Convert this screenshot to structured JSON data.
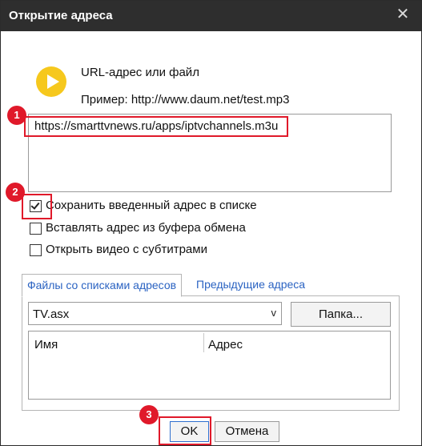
{
  "window": {
    "title": "Открытие адреса",
    "close_symbol": "✕"
  },
  "icon": "play-icon",
  "labels": {
    "url_or_file": "URL-адрес или файл",
    "example": "Пример: http://www.daum.net/test.mp3"
  },
  "url_input": {
    "value": "https://smarttvnews.ru/apps/iptvchannels.m3u"
  },
  "checkboxes": [
    {
      "label": "Сохранить введенный адрес в списке",
      "checked": true
    },
    {
      "label": "Вставлять адрес из буфера обмена",
      "checked": false
    },
    {
      "label": "Открыть видео с субтитрами",
      "checked": false
    }
  ],
  "tabs": [
    {
      "label": "Файлы со списками адресов",
      "active": true
    },
    {
      "label": "Предыдущие адреса",
      "active": false
    }
  ],
  "playlist_combo": {
    "value": "TV.asx",
    "arrow": "v"
  },
  "folder_button": "Папка...",
  "list_columns": [
    "Имя",
    "Адрес"
  ],
  "buttons": {
    "ok": "OK",
    "cancel": "Отмена"
  },
  "annotations": [
    "1",
    "2",
    "3"
  ],
  "colors": {
    "titlebar": "#2e2e2e",
    "highlight": "#e0192a",
    "tab_text": "#2b63c2",
    "play_icon": "#f6c81d"
  }
}
